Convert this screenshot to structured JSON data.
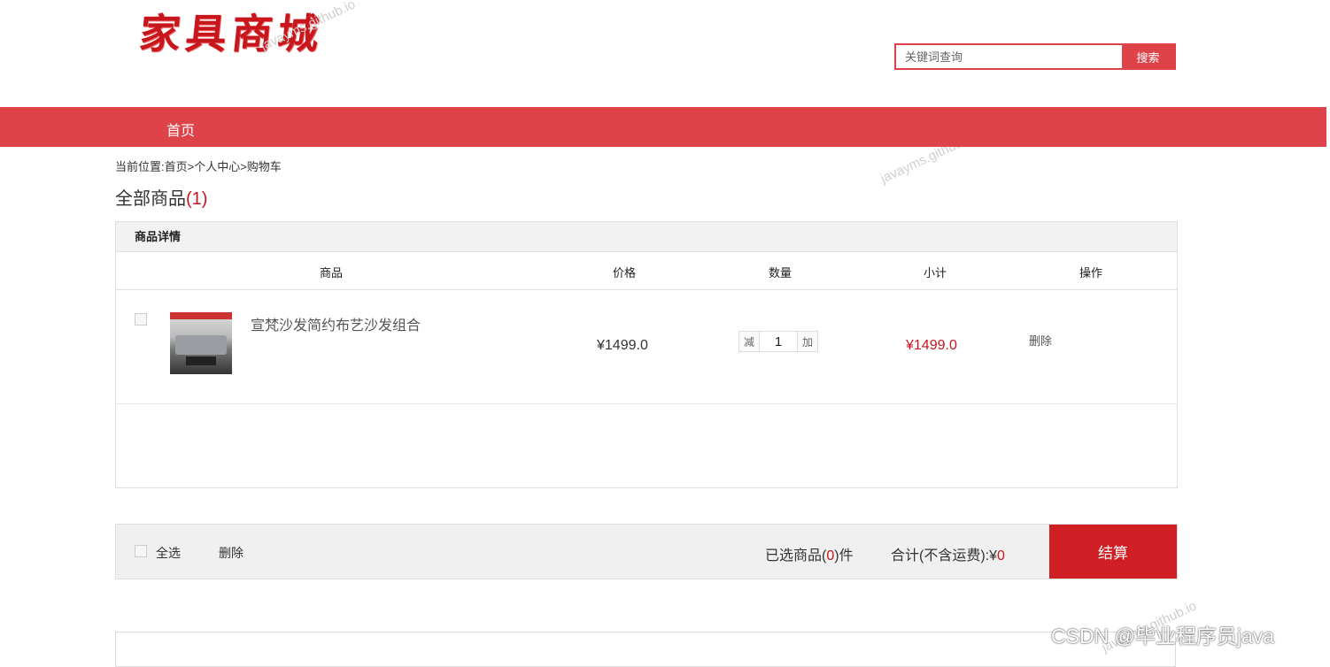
{
  "header": {
    "logo_text": "家具商城",
    "search": {
      "placeholder": "关键词查询",
      "button_label": "搜索"
    }
  },
  "nav": {
    "items": [
      {
        "label": "首页"
      }
    ]
  },
  "breadcrumb": "当前位置:首页>个人中心>购物车",
  "cart": {
    "title": "全部商品",
    "count_display": "(1)",
    "section_header": "商品详情",
    "columns": [
      "商品",
      "价格",
      "数量",
      "小计",
      "操作"
    ],
    "items": [
      {
        "name": "宣梵沙发简约布艺沙发组合",
        "price": "¥1499.0",
        "quantity": "1",
        "decrease_label": "减",
        "increase_label": "加",
        "subtotal": "¥1499.0",
        "delete_label": "删除"
      }
    ]
  },
  "footer": {
    "select_all_label": "全选",
    "delete_label": "删除",
    "selected_prefix": "已选商品(",
    "selected_count": "0",
    "selected_suffix": ")件",
    "total_label": "合计(不含运费):¥",
    "total_value": "0",
    "checkout_label": "结算"
  },
  "watermarks": [
    "javayms.github.io",
    "javayms.github.io",
    "javayms.github.io"
  ],
  "csdn_watermark": "CSDN @毕业程序员java",
  "colors": {
    "brand_red": "#de4349",
    "price_red": "#c8161d",
    "checkout_red": "#cf1f25"
  }
}
